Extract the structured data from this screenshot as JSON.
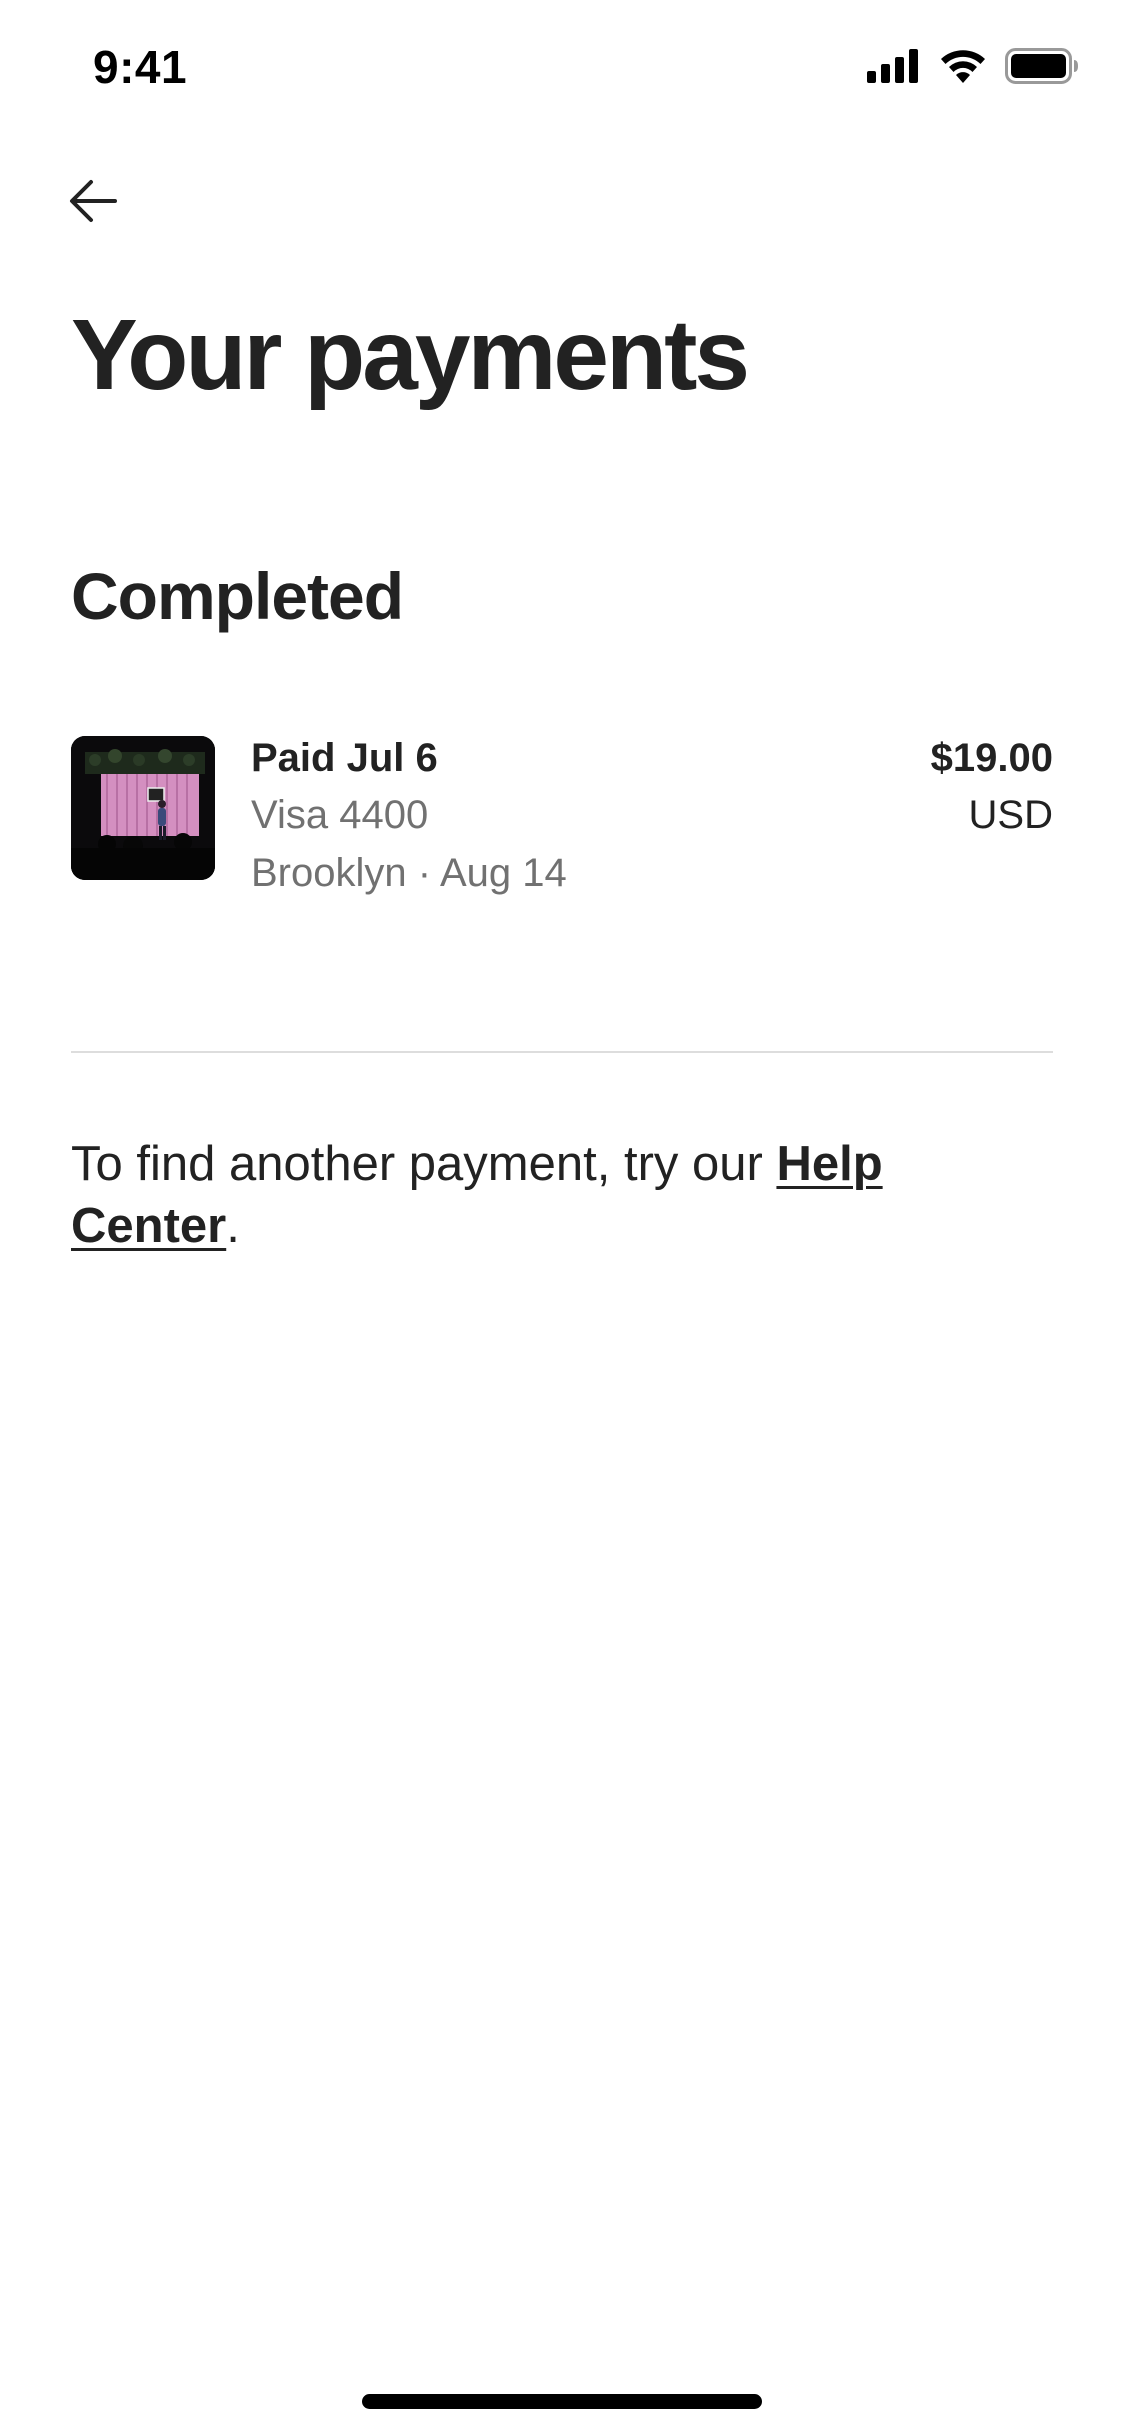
{
  "status_bar": {
    "time": "9:41"
  },
  "header": {
    "back_icon": "arrow-left-icon",
    "title": "Your payments"
  },
  "sections": [
    {
      "heading": "Completed",
      "payments": [
        {
          "thumbnail": "event-photo-thumbnail",
          "title": "Paid Jul 6",
          "card": "Visa 4400",
          "detail": "Brooklyn · Aug 14",
          "amount": "$19.00",
          "currency": "USD"
        }
      ]
    }
  ],
  "footer_note": {
    "prefix": "To find another payment, try our ",
    "link": "Help Center",
    "suffix": "."
  },
  "colors": {
    "primary_text": "#222222",
    "secondary_text": "#717171",
    "divider": "#dddddd",
    "thumbnail_pink": "#d48fc0"
  }
}
